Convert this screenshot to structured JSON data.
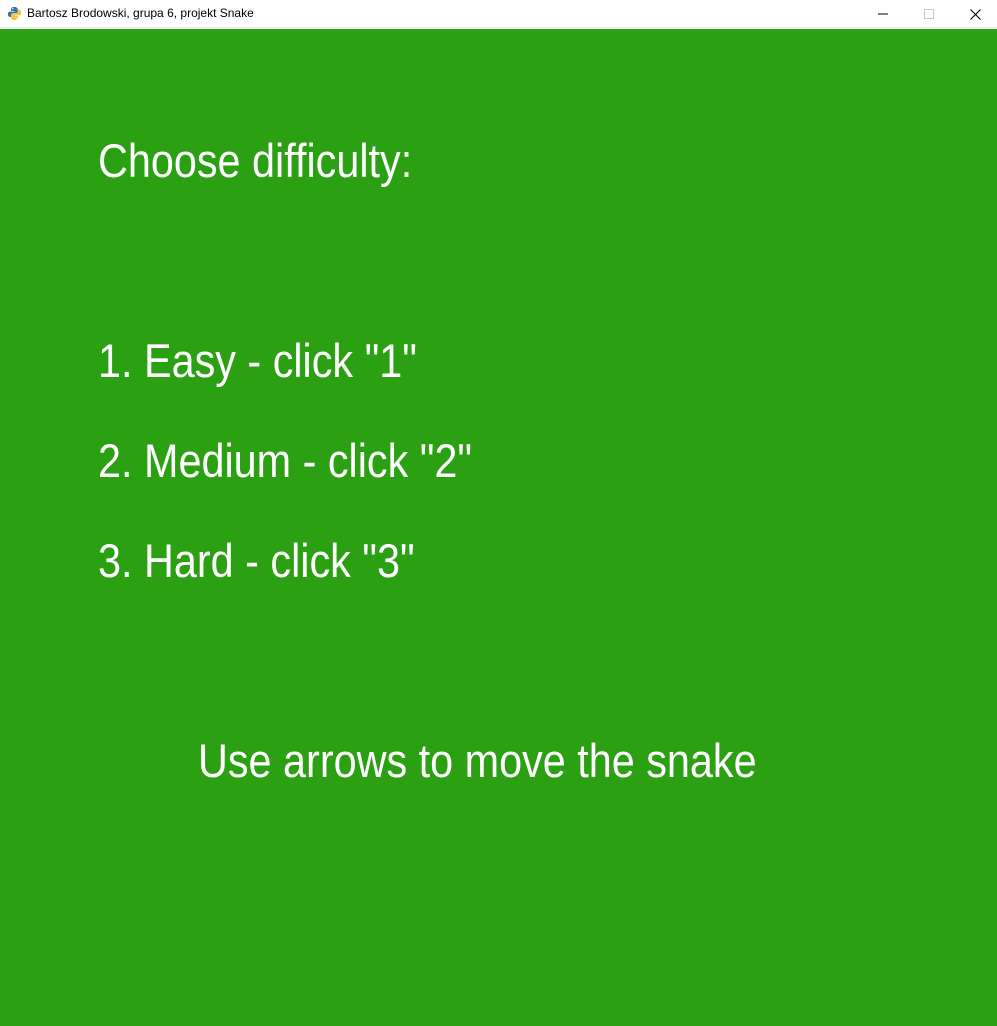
{
  "window": {
    "title": "Bartosz Brodowski, grupa 6, projekt Snake",
    "icon": "python-snake-icon",
    "controls": [
      "minimize-icon",
      "maximize-icon",
      "close-icon"
    ]
  },
  "colors": {
    "background": "#2ba012",
    "text": "#ffffff"
  },
  "menu": {
    "heading": "Choose difficulty:",
    "options": [
      "1. Easy - click \"1\"",
      "2. Medium - click \"2\"",
      "3. Hard - click \"3\""
    ],
    "hint": "Use arrows to move the snake"
  }
}
